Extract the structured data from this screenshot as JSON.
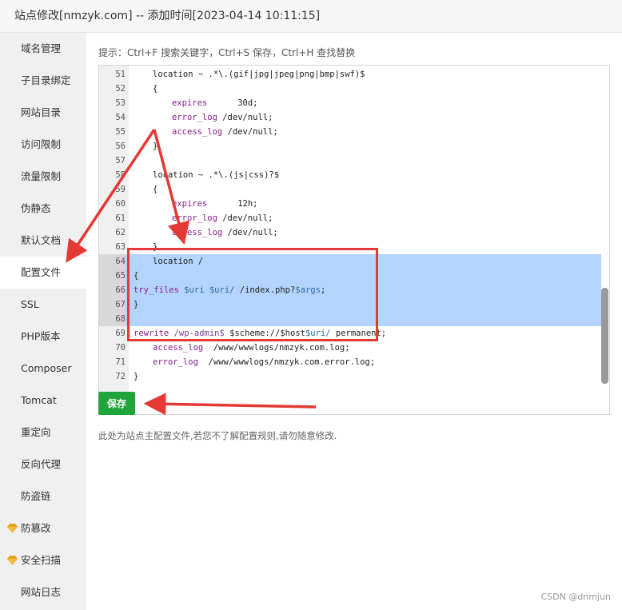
{
  "window": {
    "title": "站点修改[nmzyk.com] -- 添加时间[2023-04-14 10:11:15]"
  },
  "sidebar": {
    "items": [
      {
        "label": "域名管理",
        "active": false,
        "gem": false
      },
      {
        "label": "子目录绑定",
        "active": false,
        "gem": false
      },
      {
        "label": "网站目录",
        "active": false,
        "gem": false
      },
      {
        "label": "访问限制",
        "active": false,
        "gem": false
      },
      {
        "label": "流量限制",
        "active": false,
        "gem": false
      },
      {
        "label": "伪静态",
        "active": false,
        "gem": false
      },
      {
        "label": "默认文档",
        "active": false,
        "gem": false
      },
      {
        "label": "配置文件",
        "active": true,
        "gem": false
      },
      {
        "label": "SSL",
        "active": false,
        "gem": false
      },
      {
        "label": "PHP版本",
        "active": false,
        "gem": false
      },
      {
        "label": "Composer",
        "active": false,
        "gem": false
      },
      {
        "label": "Tomcat",
        "active": false,
        "gem": false
      },
      {
        "label": "重定向",
        "active": false,
        "gem": false
      },
      {
        "label": "反向代理",
        "active": false,
        "gem": false
      },
      {
        "label": "防盗链",
        "active": false,
        "gem": false
      },
      {
        "label": "防篡改",
        "active": false,
        "gem": true
      },
      {
        "label": "安全扫描",
        "active": false,
        "gem": true
      },
      {
        "label": "网站日志",
        "active": false,
        "gem": false
      }
    ]
  },
  "main": {
    "hint": "提示：Ctrl+F 搜索关键字，Ctrl+S 保存，Ctrl+H 查找替换",
    "save_label": "保存",
    "note": "此处为站点主配置文件,若您不了解配置规则,请勿随意修改.",
    "selection_color": "#b3d4fd",
    "accent_color": "#20a53a",
    "annotation_color": "#e53935"
  },
  "editor": {
    "lines": [
      {
        "num": "51",
        "code": "location ~ .*\\.(gif|jpg|jpeg|png|bmp|swf)$",
        "indent": 1,
        "sel": false
      },
      {
        "num": "52",
        "code": "{",
        "indent": 1,
        "sel": false
      },
      {
        "num": "53",
        "code": "expires      30d;",
        "indent": 2,
        "sel": false
      },
      {
        "num": "54",
        "code": "error_log /dev/null;",
        "indent": 2,
        "sel": false
      },
      {
        "num": "55",
        "code": "access_log /dev/null;",
        "indent": 2,
        "sel": false
      },
      {
        "num": "56",
        "code": "}",
        "indent": 1,
        "sel": false
      },
      {
        "num": "57",
        "code": "",
        "indent": 0,
        "sel": false
      },
      {
        "num": "58",
        "code": "location ~ .*\\.(js|css)?$",
        "indent": 1,
        "sel": false
      },
      {
        "num": "59",
        "code": "{",
        "indent": 1,
        "sel": false
      },
      {
        "num": "60",
        "code": "expires      12h;",
        "indent": 2,
        "sel": false
      },
      {
        "num": "61",
        "code": "error_log /dev/null;",
        "indent": 2,
        "sel": false
      },
      {
        "num": "62",
        "code": "access_log /dev/null;",
        "indent": 2,
        "sel": false
      },
      {
        "num": "63",
        "code": "}",
        "indent": 1,
        "sel": false
      },
      {
        "num": "64",
        "code": "location /",
        "indent": 1,
        "sel": true
      },
      {
        "num": "65",
        "code": "{",
        "indent": 0,
        "sel": true
      },
      {
        "num": "66",
        "code": "try_files $uri $uri/ /index.php?$args;",
        "indent": 0,
        "sel": true
      },
      {
        "num": "67",
        "code": "}",
        "indent": 0,
        "sel": true
      },
      {
        "num": "68",
        "code": "",
        "indent": 0,
        "sel": true
      },
      {
        "num": "69",
        "code": "rewrite /wp-admin$ $scheme://$host$uri/ permanent;",
        "indent": 0,
        "sel": false
      },
      {
        "num": "70",
        "code": "access_log  /www/wwwlogs/nmzyk.com.log;",
        "indent": 1,
        "sel": false
      },
      {
        "num": "71",
        "code": "error_log  /www/wwwlogs/nmzyk.com.error.log;",
        "indent": 1,
        "sel": false
      },
      {
        "num": "72",
        "code": "}",
        "indent": 0,
        "sel": false
      }
    ]
  },
  "watermark": "CSDN @dnmjun"
}
